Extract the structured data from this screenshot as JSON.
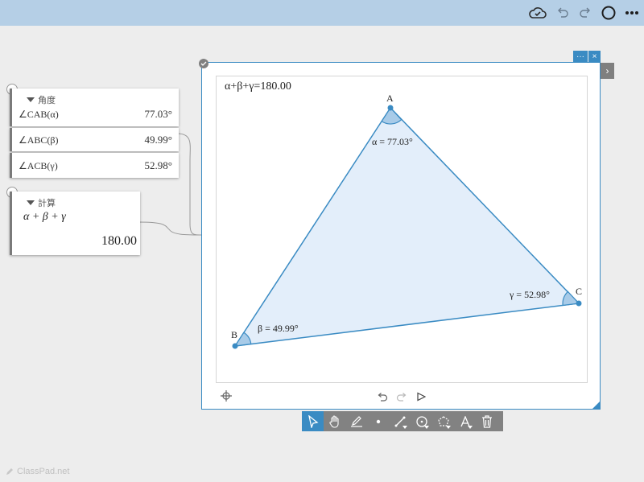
{
  "header": {
    "icons": [
      "cloud-check-icon",
      "undo-icon",
      "redo-icon",
      "circle-icon",
      "more-icon"
    ]
  },
  "angle_card": {
    "title": "角度",
    "rows": [
      {
        "label": "∠CAB(α)",
        "value": "77.03°"
      },
      {
        "label": "∠ABC(β)",
        "value": "49.99°"
      },
      {
        "label": "∠ACB(γ)",
        "value": "52.98°"
      }
    ]
  },
  "calc_card": {
    "title": "計算",
    "expression": "α + β + γ",
    "result": "180.00"
  },
  "geometry": {
    "sum_label": "α+β+γ=180.00",
    "points": {
      "A": "A",
      "B": "B",
      "C": "C"
    },
    "angle_labels": {
      "alpha": "α = 77.03°",
      "beta": "β = 49.99°",
      "gamma": "γ = 52.98°"
    },
    "window_menu": "···",
    "window_close": "×",
    "expand_arrow": "›"
  },
  "toolbar": {
    "tools": [
      "select",
      "pan",
      "draw",
      "point",
      "line",
      "circle",
      "polygon",
      "text",
      "delete"
    ],
    "active": "select"
  },
  "footer": {
    "brand": "ClassPad.net"
  },
  "colors": {
    "accent": "#3a8bc3",
    "fill": "#e3eefa",
    "topbar": "#b5cfe6"
  }
}
